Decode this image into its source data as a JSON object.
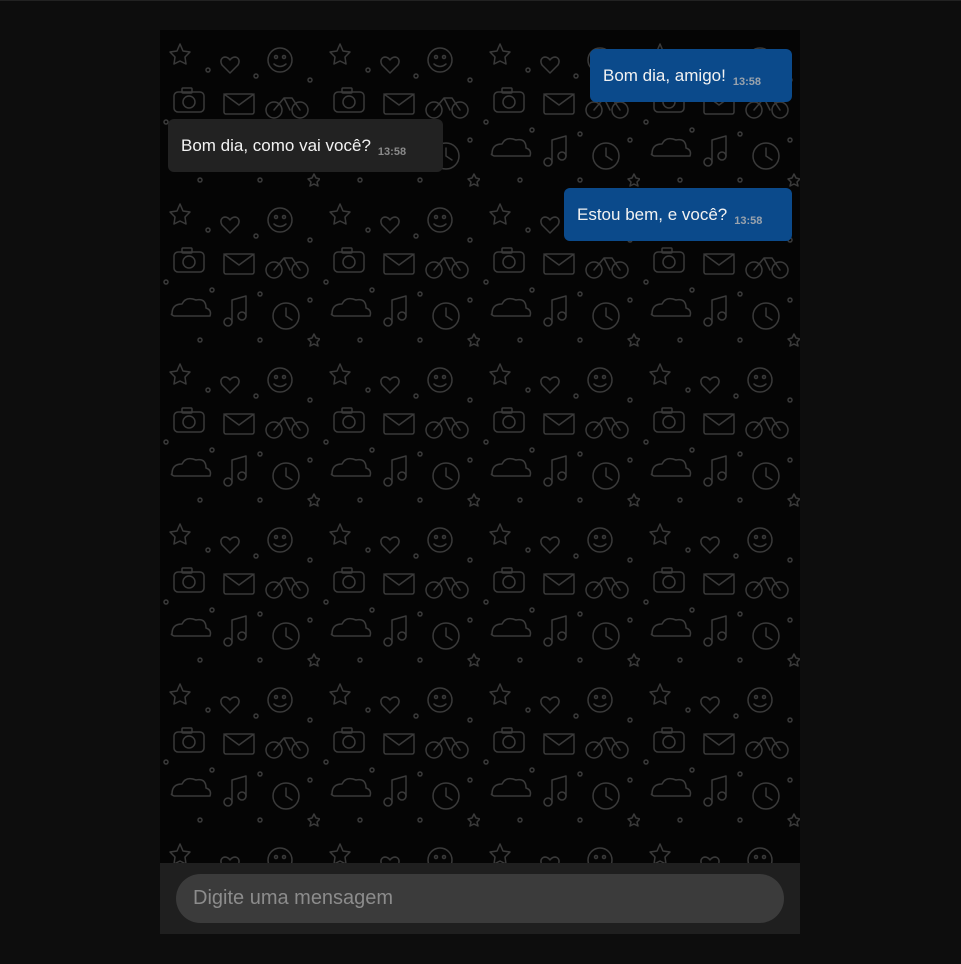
{
  "chat": {
    "messages": [
      {
        "direction": "sent",
        "text": "Bom dia, amigo!",
        "time": "13:58"
      },
      {
        "direction": "received",
        "text": "Bom dia, como vai você?",
        "time": "13:58"
      },
      {
        "direction": "sent",
        "text": "Estou bem, e você?",
        "time": "13:58"
      }
    ],
    "wallpaper_icon": "doodle-pattern"
  },
  "composer": {
    "placeholder": "Digite uma mensagem",
    "value": ""
  },
  "colors": {
    "page_background": "#0d0d0d",
    "chat_background": "#050505",
    "sent_bubble": "#0b4a8b",
    "received_bubble": "#222222",
    "composer_bar": "#1f1f1f",
    "composer_input": "#3b3b3b"
  }
}
